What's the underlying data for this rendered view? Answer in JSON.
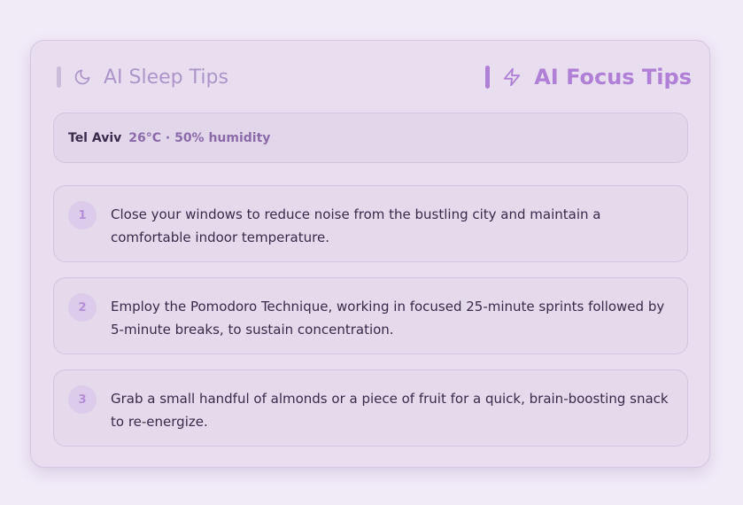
{
  "tabs": {
    "sleep": {
      "label": "AI Sleep Tips",
      "icon": "moon-icon"
    },
    "focus": {
      "label": "AI Focus Tips",
      "icon": "lightning-icon"
    }
  },
  "weather": {
    "city": "Tel Aviv",
    "conditions": "26°C · 50% humidity"
  },
  "tips": [
    {
      "number": "1",
      "text": "Close your windows to reduce noise from the bustling city and maintain a comfortable indoor temperature."
    },
    {
      "number": "2",
      "text": "Employ the Pomodoro Technique, working in focused 25-minute sprints followed by 5-minute breaks, to sustain concentration."
    },
    {
      "number": "3",
      "text": "Grab a small handful of almonds or a piece of fruit for a quick, brain-boosting snack to re-energize."
    }
  ],
  "colors": {
    "background": "#f1eaf7",
    "card": "#e8deef",
    "accent": "#b07fd6",
    "inactive": "#ad95c9",
    "text": "#3a2a4a"
  }
}
